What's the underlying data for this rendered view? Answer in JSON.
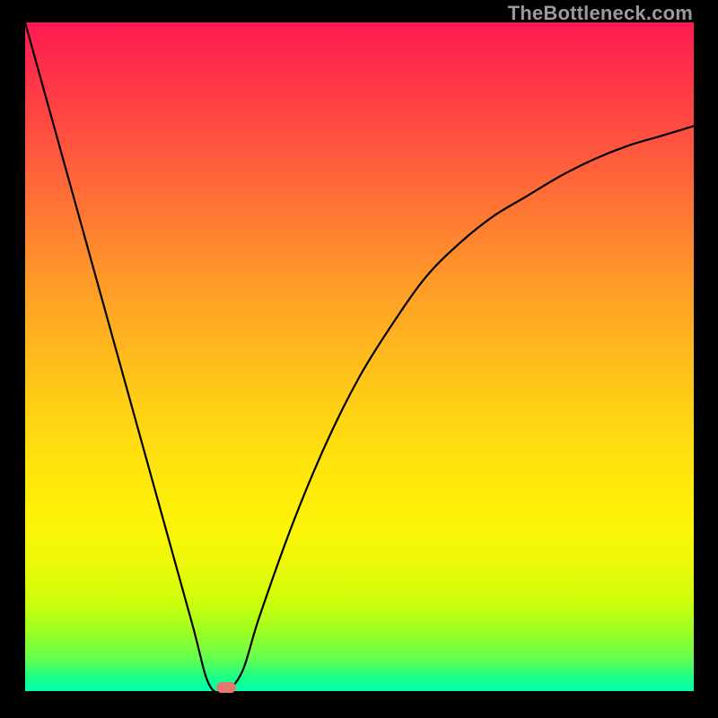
{
  "watermark": "TheBottleneck.com",
  "chart_data": {
    "type": "line",
    "title": "",
    "xlabel": "",
    "ylabel": "",
    "xlim": [
      0,
      100
    ],
    "ylim": [
      0,
      100
    ],
    "series": [
      {
        "name": "bottleneck-curve",
        "x": [
          0,
          5,
          10,
          15,
          20,
          25,
          27.5,
          30,
          32.5,
          35,
          40,
          45,
          50,
          55,
          60,
          65,
          70,
          75,
          80,
          85,
          90,
          95,
          100
        ],
        "values": [
          100,
          82,
          64,
          46,
          28,
          10,
          1,
          0,
          3,
          11,
          25,
          37,
          47,
          55,
          62,
          67,
          71,
          74,
          77,
          79.5,
          81.5,
          83,
          84.5
        ]
      }
    ],
    "marker": {
      "x": 30,
      "y": 0
    },
    "background_gradient": {
      "top": "#ff1a52",
      "bottom": "#00ffb0"
    }
  }
}
